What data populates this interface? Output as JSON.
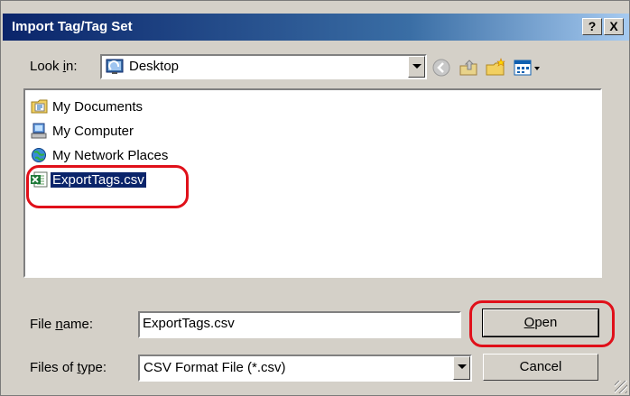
{
  "window": {
    "title": "Import Tag/Tag Set",
    "help_button": "?",
    "close_button": "X"
  },
  "look_in": {
    "label_prefix": "Look ",
    "label_mnemonic": "i",
    "label_suffix": "n:",
    "value": "Desktop",
    "icon": "desktop-icon"
  },
  "toolbar": {
    "icons": [
      "back-icon",
      "up-folder-icon",
      "new-folder-icon",
      "view-menu-icon"
    ]
  },
  "files": [
    {
      "name": "My Documents",
      "icon": "my-documents-icon",
      "selected": false
    },
    {
      "name": "My Computer",
      "icon": "my-computer-icon",
      "selected": false
    },
    {
      "name": "My Network Places",
      "icon": "network-places-icon",
      "selected": false
    },
    {
      "name": "ExportTags.csv",
      "icon": "excel-csv-icon",
      "selected": true
    }
  ],
  "file_name": {
    "label_prefix": "File ",
    "label_mnemonic": "n",
    "label_suffix": "ame:",
    "value": "ExportTags.csv"
  },
  "file_type": {
    "label_prefix": "Files of ",
    "label_mnemonic": "t",
    "label_suffix": "ype:",
    "value": "CSV Format File (*.csv)"
  },
  "buttons": {
    "open_mnemonic": "O",
    "open_rest": "pen",
    "cancel": "Cancel"
  },
  "colors": {
    "title_bar": "#0a246a",
    "dialog_face": "#d4d0c8",
    "selection": "#0a246a",
    "highlight_ring": "#e0101a"
  }
}
